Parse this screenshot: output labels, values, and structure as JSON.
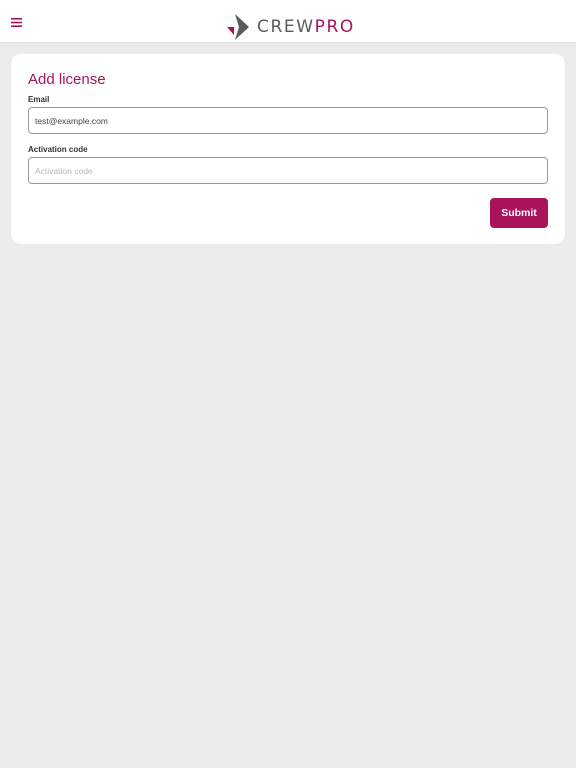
{
  "header": {
    "menu_icon": "hamburger-menu-icon",
    "logo": {
      "part1": "CREW",
      "part2": "PRO"
    }
  },
  "colors": {
    "accent": "#a8135a",
    "logo_gray": "#5b5b5b",
    "page_bg": "#ececec",
    "card_bg": "#ffffff"
  },
  "form": {
    "title": "Add license",
    "email": {
      "label": "Email",
      "value": "test@example.com",
      "placeholder": ""
    },
    "activation_code": {
      "label": "Activation code",
      "value": "",
      "placeholder": "Activation code"
    },
    "submit_label": "Submit"
  }
}
